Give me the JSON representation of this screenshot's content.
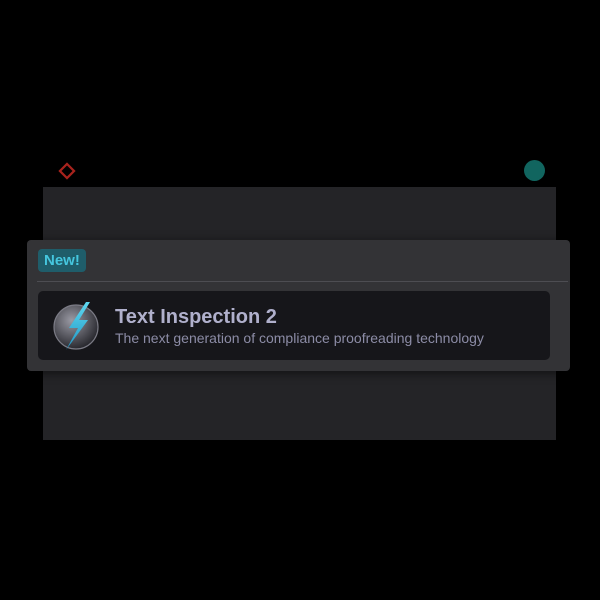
{
  "markers": {
    "left_icon": "diamond-outline-icon",
    "right_icon": "circle-icon",
    "left_color": "#a8231d",
    "right_color": "#11655f"
  },
  "popover": {
    "badge_label": "New!",
    "product": {
      "title": "Text Inspection 2",
      "description": "The next generation of compliance proofreading technology",
      "icon": "lightning-bolt-icon"
    }
  },
  "colors": {
    "background": "#000000",
    "panel": "#242427",
    "popover": "#333336",
    "badge_bg": "#1f5d6a",
    "badge_text": "#45c6de",
    "card": "#16161a",
    "title_text": "#b0b0cc",
    "desc_text": "#8c8ca6"
  }
}
